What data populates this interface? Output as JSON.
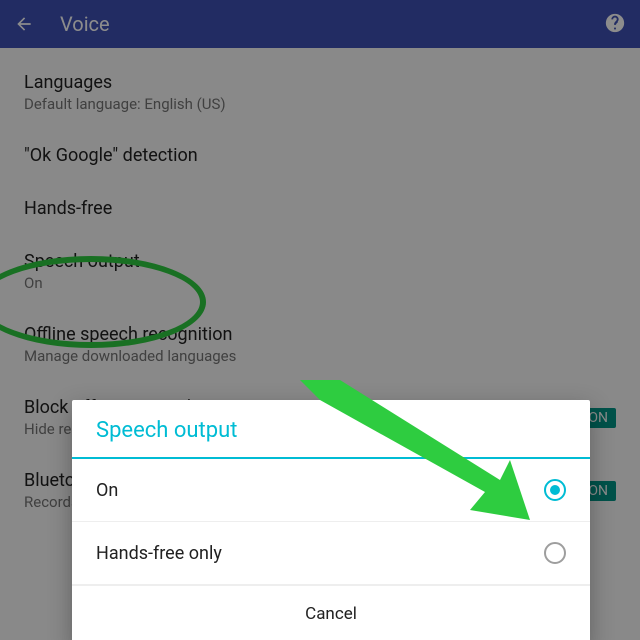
{
  "appbar": {
    "title": "Voice"
  },
  "items": {
    "languages": {
      "title": "Languages",
      "subtitle": "Default language: English (US)"
    },
    "okgoogle": {
      "title": "\"Ok Google\" detection"
    },
    "handsfree": {
      "title": "Hands-free"
    },
    "speech": {
      "title": "Speech output",
      "subtitle": "On"
    },
    "offline": {
      "title": "Offline speech recognition",
      "subtitle": "Manage downloaded languages"
    },
    "block": {
      "title": "Block offensive words",
      "subtitle": "Hide recognized offensive voice results",
      "switch": "ON"
    },
    "bluetooth": {
      "title": "Bluetooth headset",
      "subtitle": "Records audio through Bluetooth headset if available",
      "switch": "ON"
    }
  },
  "dialog": {
    "title": "Speech output",
    "options": [
      {
        "label": "On",
        "selected": true
      },
      {
        "label": "Hands-free only",
        "selected": false
      }
    ],
    "cancel": "Cancel"
  },
  "annotations": {
    "highlight": "speech-output-setting",
    "arrow_target": "dialog-option-on-radio"
  }
}
